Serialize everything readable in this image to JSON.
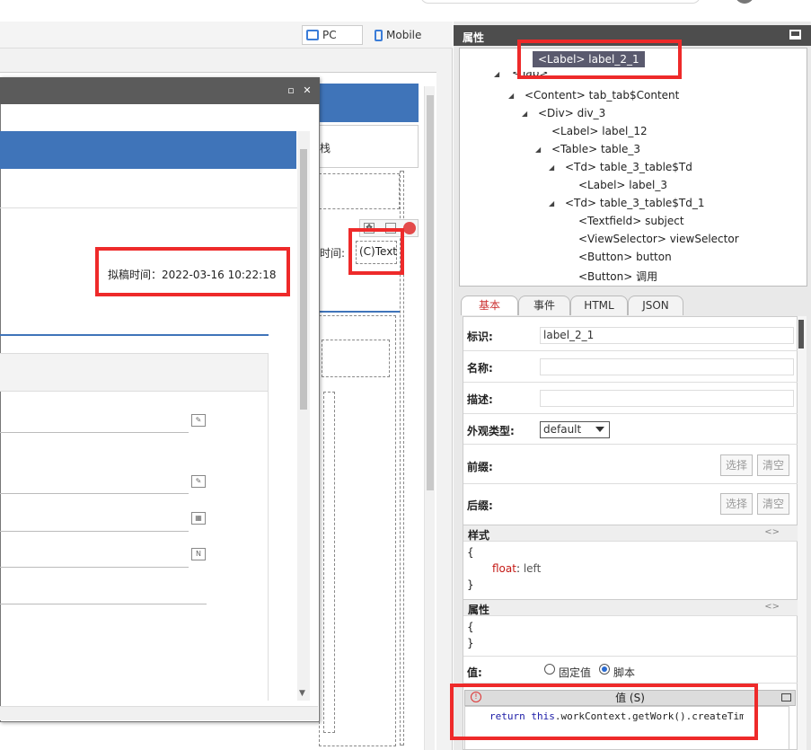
{
  "view_toggle": {
    "pc": "PC",
    "mobile": "Mobile"
  },
  "dialog": {
    "restore_icon": "▫",
    "close_icon": "✕",
    "draft_time_label": "拟稿时间：",
    "draft_time_value": "2022-03-16 10:22:18"
  },
  "canvas": {
    "partial_char": "栈",
    "time_label": "时间:",
    "text_placeholder": "(C)Text"
  },
  "properties": {
    "title": "属性",
    "tree": {
      "selected": "<Label> label_2_1",
      "nodes": [
        {
          "label": "<Tab> tab"
        },
        {
          "label": "<Content> tab_tab$Content"
        },
        {
          "label": "<Div> div_3"
        },
        {
          "label": "<Label> label_12"
        },
        {
          "label": "<Table> table_3"
        },
        {
          "label": "<Td> table_3_table$Td"
        },
        {
          "label": "<Label> label_3"
        },
        {
          "label": "<Td> table_3_table$Td_1"
        },
        {
          "label": "<Textfield> subject"
        },
        {
          "label": "<ViewSelector> viewSelector"
        },
        {
          "label": "<Button> button"
        },
        {
          "label": "<Button> 调用"
        }
      ]
    },
    "tabs": [
      "基本",
      "事件",
      "HTML",
      "JSON"
    ],
    "form": {
      "id_label": "标识:",
      "id_value": "label_2_1",
      "name_label": "名称:",
      "desc_label": "描述:",
      "appearance_label": "外观类型:",
      "appearance_value": "default",
      "prefix_label": "前缀:",
      "suffix_label": "后缀:",
      "select_btn": "选择",
      "clear_btn": "清空"
    },
    "style_section": {
      "title": "样式",
      "open": "{",
      "prop": "float",
      "value": "left",
      "close": "}"
    },
    "attr_section": {
      "title": "属性",
      "open": "{",
      "close": "}"
    },
    "value_row": {
      "label": "值:",
      "fixed": "固定值",
      "script": "脚本"
    },
    "value_editor": {
      "title": "值 (S)",
      "code_return": "return",
      "code_this": "this",
      "code_rest": ".workContext.getWork().createTim"
    }
  },
  "colors": {
    "accent_blue": "#3f74b9",
    "highlight_red": "#ee2a2a",
    "panel_header": "#4d4d4d"
  }
}
